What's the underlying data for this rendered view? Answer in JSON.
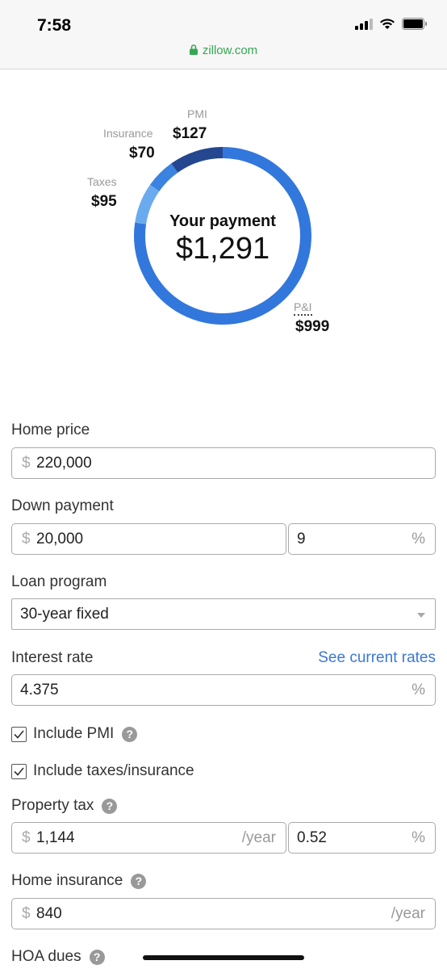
{
  "status_bar": {
    "time": "7:58",
    "url": "zillow.com"
  },
  "payment": {
    "title": "Your payment",
    "amount": "$1,291",
    "segments": [
      {
        "label": "PMI",
        "value": "$127",
        "amount": 127,
        "color": "#24478f"
      },
      {
        "label": "Insurance",
        "value": "$70",
        "amount": 70,
        "color": "#3a83e0"
      },
      {
        "label": "Taxes",
        "value": "$95",
        "amount": 95,
        "color": "#6aabf0"
      },
      {
        "label": "P&I",
        "value": "$999",
        "amount": 999,
        "color": "#3277dc"
      }
    ]
  },
  "form": {
    "home_price": {
      "label": "Home price",
      "prefix": "$",
      "value": "220,000"
    },
    "down_payment": {
      "label": "Down payment",
      "prefix": "$",
      "value": "20,000",
      "percent": "9",
      "percent_suffix": "%"
    },
    "loan_program": {
      "label": "Loan program",
      "value": "30-year fixed"
    },
    "interest_rate": {
      "label": "Interest rate",
      "link": "See current rates",
      "value": "4.375",
      "suffix": "%"
    },
    "include_pmi": {
      "label": "Include PMI",
      "checked": true,
      "help": "?"
    },
    "include_taxes": {
      "label": "Include taxes/insurance",
      "checked": true
    },
    "property_tax": {
      "label": "Property tax",
      "help": "?",
      "prefix": "$",
      "value": "1,144",
      "unit": "/year",
      "percent": "0.52",
      "percent_suffix": "%"
    },
    "home_insurance": {
      "label": "Home insurance",
      "help": "?",
      "prefix": "$",
      "value": "840",
      "unit": "/year"
    },
    "hoa_dues": {
      "label": "HOA dues",
      "help": "?"
    }
  }
}
